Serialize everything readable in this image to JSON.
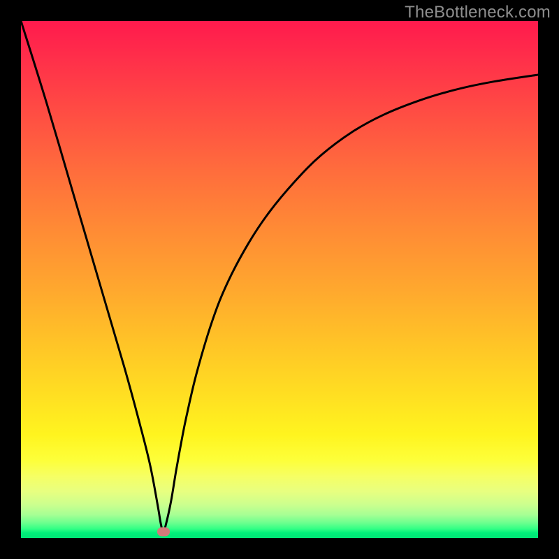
{
  "watermark": "TheBottleneck.com",
  "chart_data": {
    "type": "line",
    "title": "",
    "xlabel": "",
    "ylabel": "",
    "xlim": [
      0,
      100
    ],
    "ylim": [
      0,
      100
    ],
    "grid": false,
    "legend": null,
    "series": [
      {
        "name": "bottleneck-curve",
        "x": [
          0,
          5,
          10,
          15,
          20,
          23,
          25,
          26.5,
          27,
          27.5,
          28,
          29,
          30,
          31,
          32,
          34,
          37,
          40,
          44,
          48,
          53,
          58,
          64,
          70,
          77,
          84,
          91,
          100
        ],
        "values": [
          100,
          84,
          67,
          50,
          33,
          22,
          14,
          6,
          3,
          1.2,
          2.5,
          7,
          13,
          18.5,
          23.5,
          32,
          42,
          49.5,
          57,
          63,
          69,
          74,
          78.5,
          81.8,
          84.6,
          86.7,
          88.2,
          89.6
        ]
      }
    ],
    "annotations": [
      {
        "name": "min-marker",
        "x": 27.5,
        "y": 1.2,
        "shape": "pill",
        "color": "#d47a7a"
      }
    ],
    "background_gradient": {
      "top": "#ff1a4d",
      "mid": "#ffde22",
      "bottom": "#00e676"
    }
  }
}
